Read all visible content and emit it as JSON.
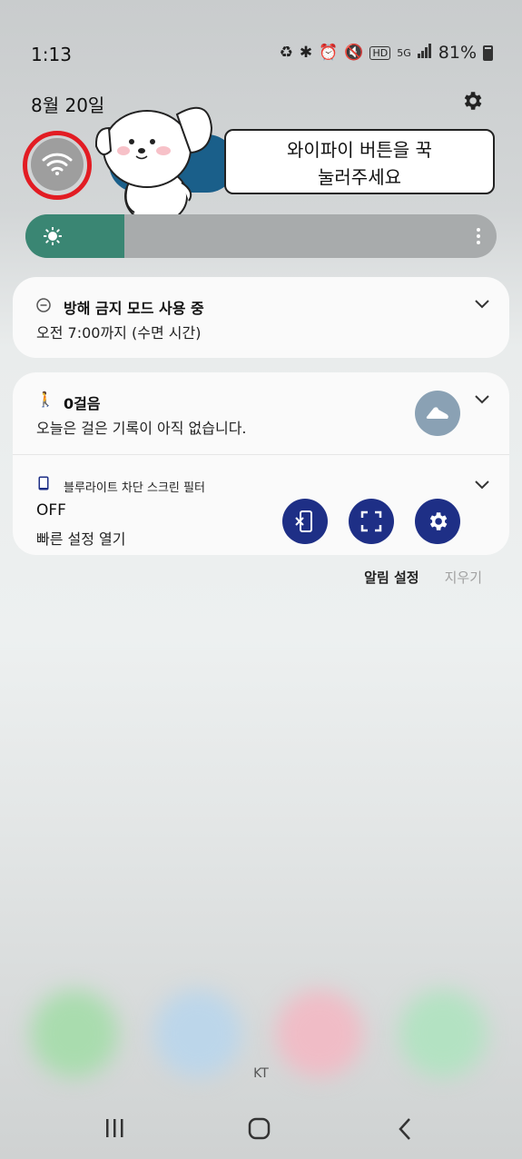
{
  "status_bar": {
    "time": "1:13",
    "battery": "81%"
  },
  "header": {
    "date": "8월 20일"
  },
  "bubble": {
    "line1": "와이파이 버튼을 꾹",
    "line2": "눌러주세요"
  },
  "brightness": {
    "level": 0.21
  },
  "notifications": [
    {
      "title": "방해 금지 모드 사용 중",
      "body": "오전 7:00까지 (수면 시간)"
    },
    {
      "title": "0걸음",
      "body": "오늘은 걸은 기록이 아직 없습니다."
    },
    {
      "app": "블루라이트 차단 스크린 필터",
      "state": "OFF",
      "body": "빠른 설정 열기"
    }
  ],
  "actions": {
    "settings": "알림 설정",
    "clear": "지우기"
  },
  "carrier": "KT",
  "colors": {
    "wifi_ring": "#e21c23",
    "brightness_fill": "#3a8673",
    "action_button": "#1e2f86"
  }
}
